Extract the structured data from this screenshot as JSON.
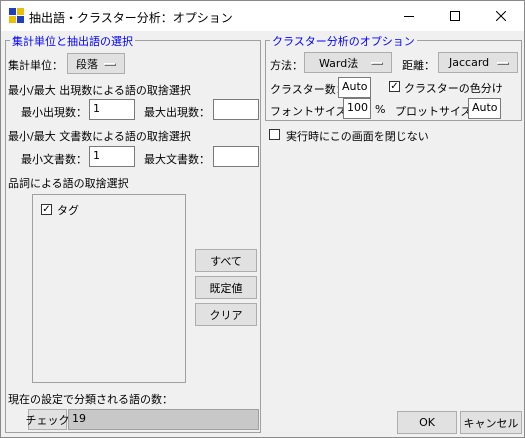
{
  "window": {
    "title": "抽出語・クラスター分析：オプション",
    "minimize_icon": "minimize-icon",
    "maximize_icon": "maximize-icon",
    "close_icon": "close-icon"
  },
  "left_group": {
    "title": "集計単位と抽出語の選択",
    "unit_label": "集計単位：",
    "unit_value": "段落",
    "freq_section_label": "最小/最大 出現数による語の取捨選択",
    "min_freq_label": "最小出現数：",
    "min_freq_value": "1",
    "max_freq_label": "最大出現数：",
    "max_freq_value": "",
    "doc_section_label": "最小/最大 文書数による語の取捨選択",
    "min_doc_label": "最小文書数：",
    "min_doc_value": "1",
    "max_doc_label": "最大文書数：",
    "max_doc_value": "",
    "pos_section_label": "品詞による語の取捨選択",
    "pos_items": [
      {
        "label": "タグ",
        "checked": true
      }
    ],
    "all_button": "すべて",
    "default_button": "既定値",
    "clear_button": "クリア",
    "count_label": "現在の設定で分類される語の数：",
    "check_button": "チェック",
    "count_value": "19"
  },
  "right_group": {
    "title": "クラスター分析のオプション",
    "method_label": "方法：",
    "method_value": "Ward法",
    "distance_label": "距離：",
    "distance_value": "Jaccard",
    "cluster_count_label": "クラスター数：",
    "cluster_count_value": "Auto",
    "color_checkbox_label": "クラスターの色分け",
    "color_checked": true,
    "font_size_label": "フォントサイズ：",
    "font_size_value": "100",
    "font_size_unit": "%",
    "plot_size_label": "プロットサイズ：",
    "plot_size_value": "Auto"
  },
  "keep_open_label": "実行時にこの画面を閉じない",
  "keep_open_checked": false,
  "ok_button": "OK",
  "cancel_button": "キャンセル",
  "checkmark": "✓"
}
